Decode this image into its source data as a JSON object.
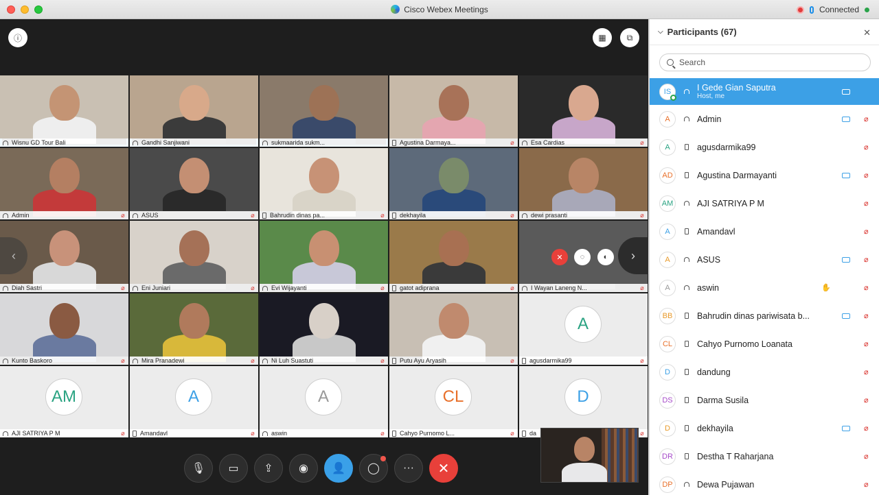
{
  "window": {
    "title": "Cisco Webex Meetings",
    "status": "Connected"
  },
  "panel": {
    "title": "Participants (67)",
    "search_placeholder": "Search",
    "participants": [
      {
        "initials": "IS",
        "name": "I Gede Gian Saputra",
        "sub": "Host, me",
        "device": "headset",
        "video": true,
        "muted": false,
        "color": "#3ca0e6"
      },
      {
        "initials": "A",
        "name": "Admin",
        "device": "headset",
        "video": true,
        "muted": true,
        "color": "#e8702a"
      },
      {
        "initials": "A",
        "name": "agusdarmika99",
        "device": "phone",
        "video": false,
        "muted": true,
        "color": "#2aa382"
      },
      {
        "initials": "AD",
        "name": "Agustina Darmayanti",
        "device": "phone",
        "video": true,
        "muted": true,
        "color": "#e8702a"
      },
      {
        "initials": "AM",
        "name": "AJI SATRIYA P M",
        "device": "headset",
        "video": false,
        "muted": true,
        "color": "#2aa382"
      },
      {
        "initials": "A",
        "name": "Amandavl",
        "device": "phone",
        "video": false,
        "muted": true,
        "color": "#3ca0e6"
      },
      {
        "initials": "A",
        "name": "ASUS",
        "device": "headset",
        "video": true,
        "muted": true,
        "color": "#e89a2a"
      },
      {
        "initials": "A",
        "name": "aswin",
        "device": "headset",
        "video": false,
        "muted": true,
        "hand": true,
        "color": "#999999"
      },
      {
        "initials": "BB",
        "name": "Bahrudin dinas pariwisata b...",
        "device": "phone",
        "video": true,
        "muted": true,
        "color": "#e89a2a"
      },
      {
        "initials": "CL",
        "name": "Cahyo Purnomo Loanata",
        "device": "phone",
        "video": false,
        "muted": true,
        "color": "#e8702a"
      },
      {
        "initials": "D",
        "name": "dandung",
        "device": "phone",
        "video": false,
        "muted": true,
        "color": "#3ca0e6"
      },
      {
        "initials": "DS",
        "name": "Darma Susila",
        "device": "phone",
        "video": false,
        "muted": true,
        "color": "#a64ac9"
      },
      {
        "initials": "D",
        "name": "dekhayila",
        "device": "phone",
        "video": true,
        "muted": true,
        "color": "#e89a2a"
      },
      {
        "initials": "DR",
        "name": "Destha T Raharjana",
        "device": "phone",
        "video": false,
        "muted": true,
        "color": "#a64ac9"
      },
      {
        "initials": "DP",
        "name": "Dewa Pujawan",
        "device": "headset",
        "video": false,
        "muted": true,
        "color": "#e8702a"
      }
    ]
  },
  "tiles": [
    {
      "name": "Wisnu GD Tour Bali",
      "device": "headset",
      "muted": false,
      "active": true,
      "bg": "#c9c0b3",
      "skin": "#c49474",
      "shirt": "#eeeeee"
    },
    {
      "name": "Gandhi Sanjiwani",
      "device": "headset",
      "muted": false,
      "active": true,
      "bg": "#b9a58f",
      "skin": "#d8a98a",
      "shirt": "#3b3b3b"
    },
    {
      "name": "sukmaarida sukm...",
      "device": "headset",
      "muted": false,
      "active": true,
      "bg": "#8a7a6a",
      "skin": "#9d7256",
      "shirt": "#3a4a6a"
    },
    {
      "name": "Agustina Darmaya...",
      "device": "phone",
      "muted": true,
      "active": false,
      "bg": "#c7b9a8",
      "skin": "#a87258",
      "shirt": "#e4a6b0"
    },
    {
      "name": "Esa Cardias",
      "device": "headset",
      "muted": true,
      "active": false,
      "bg": "#2a2a2a",
      "skin": "#d9a88f",
      "shirt": "#c7a6c9"
    },
    {
      "name": "Admin",
      "device": "headset",
      "muted": true,
      "active": false,
      "bg": "#7a6a58",
      "skin": "#b47f62",
      "shirt": "#c33a3a"
    },
    {
      "name": "ASUS",
      "device": "headset",
      "muted": true,
      "active": false,
      "bg": "#4a4a4a",
      "skin": "#c48f73",
      "shirt": "#2a2a2a"
    },
    {
      "name": "Bahrudin dinas pa...",
      "device": "phone",
      "muted": true,
      "active": false,
      "bg": "#e8e4dc",
      "skin": "#c79276",
      "shirt": "#d9d4c8"
    },
    {
      "name": "dekhayila",
      "device": "phone",
      "muted": true,
      "active": false,
      "bg": "#5d6a7a",
      "skin": "#7a8b6a",
      "shirt": "#2a4a7a"
    },
    {
      "name": "dewi prasanti",
      "device": "headset",
      "muted": true,
      "active": false,
      "bg": "#8a6a4a",
      "skin": "#b88566",
      "shirt": "#a8a8b8"
    },
    {
      "name": "Diah Sastri",
      "device": "headset",
      "muted": true,
      "active": false,
      "bg": "#6a5a4a",
      "skin": "#c8927a",
      "shirt": "#d8d8d8"
    },
    {
      "name": "Eni Juniari",
      "device": "headset",
      "muted": true,
      "active": false,
      "bg": "#d8d2ca",
      "skin": "#a57157",
      "shirt": "#6a6a6a"
    },
    {
      "name": "Evi Wijayanti",
      "device": "headset",
      "muted": true,
      "active": false,
      "bg": "#5a8a4a",
      "skin": "#c89072",
      "shirt": "#c8c8d8"
    },
    {
      "name": "gatot adiprana",
      "device": "phone",
      "muted": true,
      "active": false,
      "bg": "#9a7a4a",
      "skin": "#a87052",
      "shirt": "#3a3a3a"
    },
    {
      "name": "I Wayan Laneng N...",
      "device": "headset",
      "muted": true,
      "active": false,
      "bg": "#5a5a5a",
      "skin": "#5a5a5a",
      "shirt": "#5a5a5a"
    },
    {
      "name": "Kunto Baskoro",
      "device": "headset",
      "muted": true,
      "active": false,
      "bg": "#d8d8da",
      "skin": "#8a5a42",
      "shirt": "#6a7aa0"
    },
    {
      "name": "Mira Pranadewi",
      "device": "headset",
      "muted": true,
      "active": false,
      "bg": "#5a6a3a",
      "skin": "#b07a5c",
      "shirt": "#d8b83a"
    },
    {
      "name": "Ni Luh Suastuti",
      "device": "headset",
      "muted": true,
      "active": false,
      "bg": "#1a1a24",
      "skin": "#d8d0c8",
      "shirt": "#c8c8c8"
    },
    {
      "name": "Putu Ayu Aryasih",
      "device": "phone",
      "muted": true,
      "active": false,
      "bg": "#c8bfb4",
      "skin": "#c08a6e",
      "shirt": "#f0f0f0"
    },
    {
      "name": "agusdarmika99",
      "device": "phone",
      "muted": true,
      "active": false,
      "avatar": "A",
      "color": "#2aa382"
    },
    {
      "name": "AJI SATRIYA P M",
      "device": "headset",
      "muted": true,
      "active": false,
      "avatar": "AM",
      "color": "#2aa382"
    },
    {
      "name": "Amandavl",
      "device": "phone",
      "muted": true,
      "active": false,
      "avatar": "A",
      "color": "#3ca0e6"
    },
    {
      "name": "aswin",
      "device": "headset",
      "muted": true,
      "active": false,
      "avatar": "A",
      "color": "#999999"
    },
    {
      "name": "Cahyo Purnomo L...",
      "device": "phone",
      "muted": true,
      "active": false,
      "avatar": "CL",
      "color": "#e8702a"
    },
    {
      "name": "da",
      "device": "phone",
      "muted": true,
      "active": false,
      "avatar": "D",
      "color": "#3ca0e6"
    }
  ],
  "icons": {
    "info": "info-icon",
    "layout": "grid-layout-icon",
    "popout": "popout-icon",
    "mute": "microphone-off-icon",
    "video": "video-off-icon",
    "share": "share-icon",
    "record": "record-icon",
    "participants": "participants-icon",
    "chat": "chat-icon",
    "more": "more-icon",
    "end": "close-icon"
  },
  "controls": {
    "more_glyph": "···"
  }
}
